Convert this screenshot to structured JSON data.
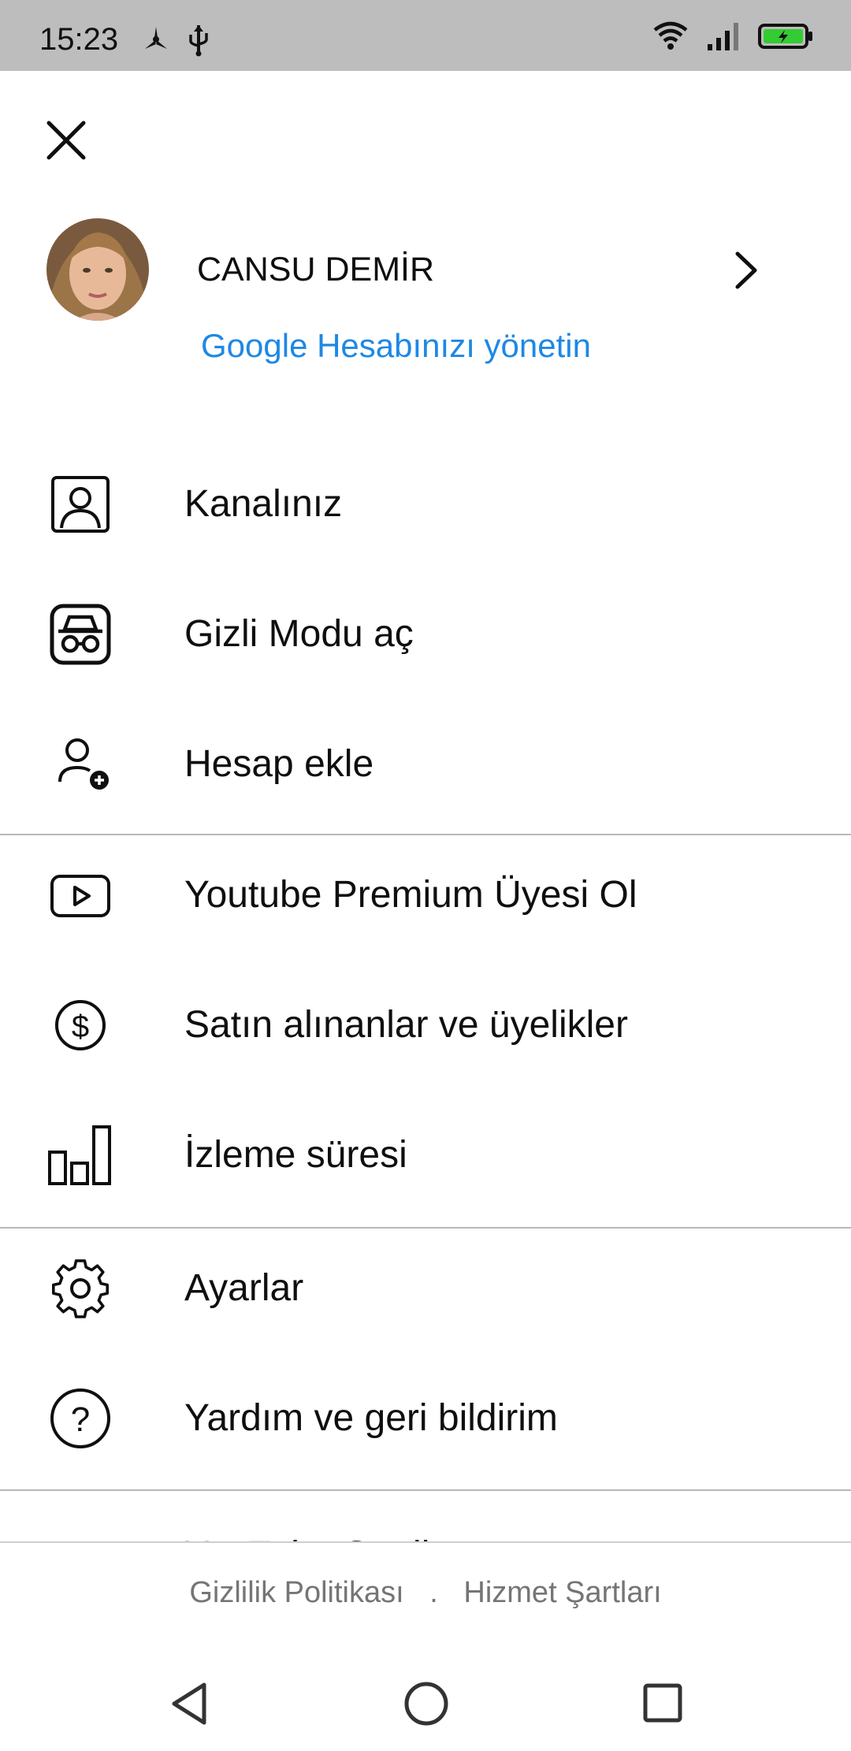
{
  "status_bar": {
    "time": "15:23",
    "left_icons": [
      "fan-icon",
      "usb-icon"
    ],
    "right_icons": [
      "wifi-icon",
      "signal-icon",
      "battery-charging-icon"
    ],
    "battery_color": "#33cc33"
  },
  "account": {
    "name": "CANSU DEMİR",
    "manage_link": "Google Hesabınızı yönetin",
    "link_color": "#1e88e5"
  },
  "menu": {
    "group1": [
      {
        "label": "Kanalınız",
        "icon": "channel-icon"
      },
      {
        "label": "Gizli Modu aç",
        "icon": "incognito-icon"
      },
      {
        "label": "Hesap ekle",
        "icon": "add-account-icon"
      }
    ],
    "group2": [
      {
        "label": "Youtube Premium Üyesi Ol",
        "icon": "youtube-play-icon"
      },
      {
        "label": "Satın alınanlar ve üyelikler",
        "icon": "dollar-icon"
      },
      {
        "label": "İzleme süresi",
        "icon": "bar-chart-icon"
      }
    ],
    "group3": [
      {
        "label": "Ayarlar",
        "icon": "gear-icon"
      },
      {
        "label": "Yardım ve geri bildirim",
        "icon": "help-icon"
      }
    ],
    "group4": [
      {
        "label": "YouTube Studio",
        "icon": "studio-icon",
        "icon_color": "#e62117"
      }
    ]
  },
  "footer": {
    "privacy": "Gizlilik Politikası",
    "separator": ".",
    "terms": "Hizmet Şartları"
  },
  "nav_bar": [
    "back-icon",
    "home-icon",
    "recents-icon"
  ]
}
